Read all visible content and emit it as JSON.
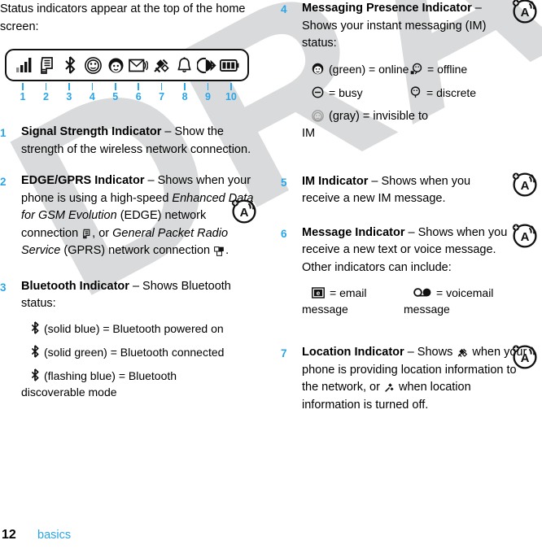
{
  "intro": "Status indicators appear at the top of the home screen:",
  "figure": {
    "name": "status-bar-illustration",
    "icons": [
      {
        "n": 1,
        "icon": "signal-strength-icon"
      },
      {
        "n": 2,
        "icon": "edge-gprs-icon"
      },
      {
        "n": 3,
        "icon": "bluetooth-icon"
      },
      {
        "n": 4,
        "icon": "messaging-presence-icon"
      },
      {
        "n": 5,
        "icon": "im-icon"
      },
      {
        "n": 6,
        "icon": "message-envelope-icon"
      },
      {
        "n": 7,
        "icon": "location-satellite-icon"
      },
      {
        "n": 8,
        "icon": "ringer-bell-icon"
      },
      {
        "n": 9,
        "icon": "call-forward-icon"
      },
      {
        "n": 10,
        "icon": "battery-icon"
      }
    ],
    "labels": [
      "1",
      "2",
      "3",
      "4",
      "5",
      "6",
      "7",
      "8",
      "9",
      "10"
    ]
  },
  "items": [
    {
      "num": "1",
      "title": "Signal Strength Indicator",
      "dash": " – ",
      "text": "Show the strength of the wireless network connection."
    },
    {
      "num": "2",
      "title": "EDGE/GPRS Indicator",
      "dash": " – ",
      "t1": "Shows when your phone is using a high-speed ",
      "em1": "Enhanced Data for GSM Evolution",
      "t2": " (EDGE) network connection ",
      "t3": ", or ",
      "em2": "General Packet Radio Service",
      "t4": " (GPRS) network connection ",
      "t5": "."
    },
    {
      "num": "3",
      "title": "Bluetooth Indicator",
      "dash": " – ",
      "text": "Shows Bluetooth status:",
      "defs": [
        {
          "icon": "bluetooth-icon",
          "label": "(solid blue) = Bluetooth powered on"
        },
        {
          "icon": "bluetooth-icon",
          "label": "(solid green) = Bluetooth connected"
        },
        {
          "icon": "bluetooth-icon",
          "label": "(flashing blue) = Bluetooth",
          "label2": "discoverable mode"
        }
      ]
    },
    {
      "num": "4",
      "title": "Messaging Presence Indicator",
      "dash": " – ",
      "text": "Shows your instant messaging (IM) status:",
      "grid": [
        {
          "icon": "presence-online-icon",
          "label": "(green) = online"
        },
        {
          "icon": "presence-offline-icon",
          "label": "= offline"
        },
        {
          "icon": "presence-busy-icon",
          "label": "= busy"
        },
        {
          "icon": "presence-discrete-icon",
          "label": "= discrete"
        },
        {
          "icon": "presence-invisible-icon",
          "label": "(gray) = invisible to",
          "label2": "IM"
        }
      ]
    },
    {
      "num": "5",
      "title": "IM Indicator",
      "dash": " – ",
      "text": "Shows when you receive a new IM message."
    },
    {
      "num": "6",
      "title": "Message Indicator",
      "dash": " – ",
      "text": "Shows when you receive a new text or voice message. Other indicators can include:",
      "grid": [
        {
          "icon": "email-icon",
          "label": "= email",
          "label2": "message"
        },
        {
          "icon": "voicemail-icon",
          "label": "= voicemail",
          "label2": "message"
        }
      ]
    },
    {
      "num": "7",
      "title": "Location Indicator",
      "dash": " – ",
      "t1": "Shows ",
      "t2": " when your phone is providing location information to the network, or ",
      "t3": " when location information is turned off."
    }
  ],
  "note_icon_name": "note-tip-icon",
  "footer": {
    "page_number": "12",
    "section": "basics"
  },
  "watermark": {
    "text": "DRAFT",
    "color": "#d9dadb"
  },
  "colors": {
    "accent_blue": "#2aa6e8",
    "text": "#000000",
    "outline": "#111111"
  }
}
